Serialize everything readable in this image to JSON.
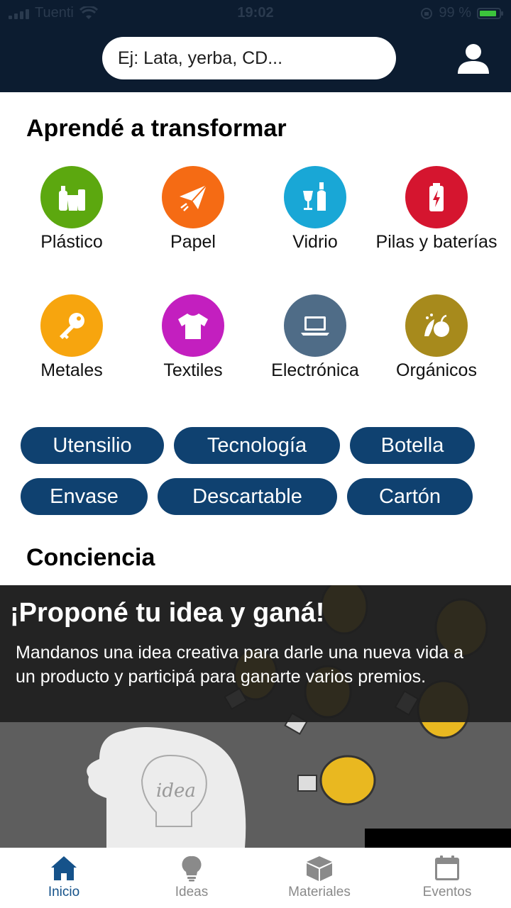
{
  "status_bar": {
    "carrier": "Tuenti",
    "time": "19:02",
    "battery": "99 %"
  },
  "search": {
    "placeholder": "Ej: Lata, yerba, CD..."
  },
  "learn": {
    "title": "Aprendé a transformar",
    "categories": [
      {
        "label": "Plástico",
        "icon": "plastic-bottle-icon",
        "color": "#5ca80f"
      },
      {
        "label": "Papel",
        "icon": "paper-plane-icon",
        "color": "#f56b14"
      },
      {
        "label": "Vidrio",
        "icon": "glass-bottle-icon",
        "color": "#19a7d6"
      },
      {
        "label": "Pilas y baterías",
        "icon": "battery-icon",
        "color": "#d5152f"
      },
      {
        "label": "Metales",
        "icon": "key-icon",
        "color": "#f7a50e"
      },
      {
        "label": "Textiles",
        "icon": "tshirt-icon",
        "color": "#c31fbf"
      },
      {
        "label": "Electrónica",
        "icon": "laptop-icon",
        "color": "#4f6c87"
      },
      {
        "label": "Orgánicos",
        "icon": "fruit-icon",
        "color": "#a78a1c"
      }
    ]
  },
  "tags": [
    "Utensilio",
    "Tecnología",
    "Botella",
    "Envase",
    "Descartable",
    "Cartón"
  ],
  "conciencia": {
    "title": "Conciencia",
    "banner_title": "¡Proponé tu idea y ganá!",
    "banner_text": "Mandanos una idea creativa para darle una nueva vida a un producto y participá para ganarte varios premios.",
    "banner_image_text": "idea"
  },
  "bottom_nav": [
    {
      "label": "Inicio",
      "icon": "home-icon",
      "active": true
    },
    {
      "label": "Ideas",
      "icon": "lightbulb-icon",
      "active": false
    },
    {
      "label": "Materiales",
      "icon": "box-icon",
      "active": false
    },
    {
      "label": "Eventos",
      "icon": "calendar-icon",
      "active": false
    }
  ],
  "colors": {
    "header": "#0c1c30",
    "tag": "#0f4170",
    "active_nav": "#15528a",
    "inactive_nav": "#8a8a8a"
  }
}
